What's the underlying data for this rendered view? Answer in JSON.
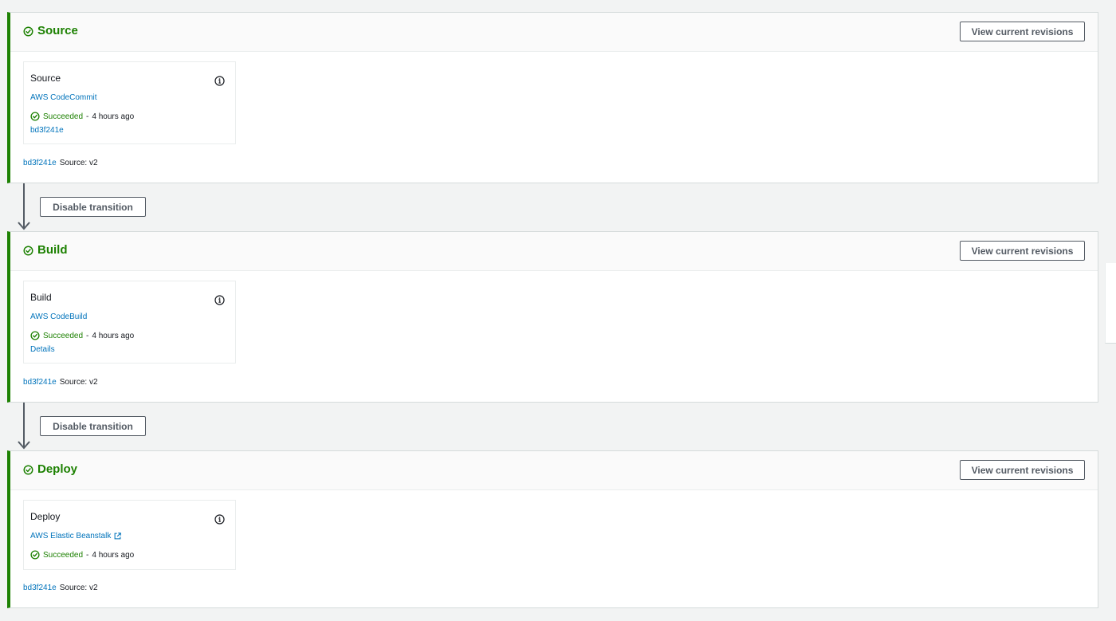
{
  "stages": [
    {
      "title": "Source",
      "view_button": "View current revisions",
      "action": {
        "name": "Source",
        "provider": "AWS CodeCommit",
        "status": "Succeeded",
        "separator": "-",
        "time": "4 hours ago",
        "extra_link": "bd3f241e"
      },
      "revision": {
        "id": "bd3f241e",
        "message": "Source: v2"
      }
    },
    {
      "title": "Build",
      "view_button": "View current revisions",
      "action": {
        "name": "Build",
        "provider": "AWS CodeBuild",
        "status": "Succeeded",
        "separator": "-",
        "time": "4 hours ago",
        "extra_link": "Details"
      },
      "revision": {
        "id": "bd3f241e",
        "message": "Source: v2"
      }
    },
    {
      "title": "Deploy",
      "view_button": "View current revisions",
      "action": {
        "name": "Deploy",
        "provider": "AWS Elastic Beanstalk",
        "status": "Succeeded",
        "separator": "-",
        "time": "4 hours ago"
      },
      "revision": {
        "id": "bd3f241e",
        "message": "Source: v2"
      }
    }
  ],
  "transitions": [
    {
      "button": "Disable transition"
    },
    {
      "button": "Disable transition"
    }
  ],
  "colors": {
    "success": "#1d8102",
    "link": "#0073bb",
    "border": "#d5dbdb",
    "background": "#f2f3f3"
  },
  "icons": {
    "stage_status": "check-circle-icon",
    "info": "info-icon",
    "external_link": "external-link-icon",
    "transition_arrow": "arrow-down-icon"
  }
}
